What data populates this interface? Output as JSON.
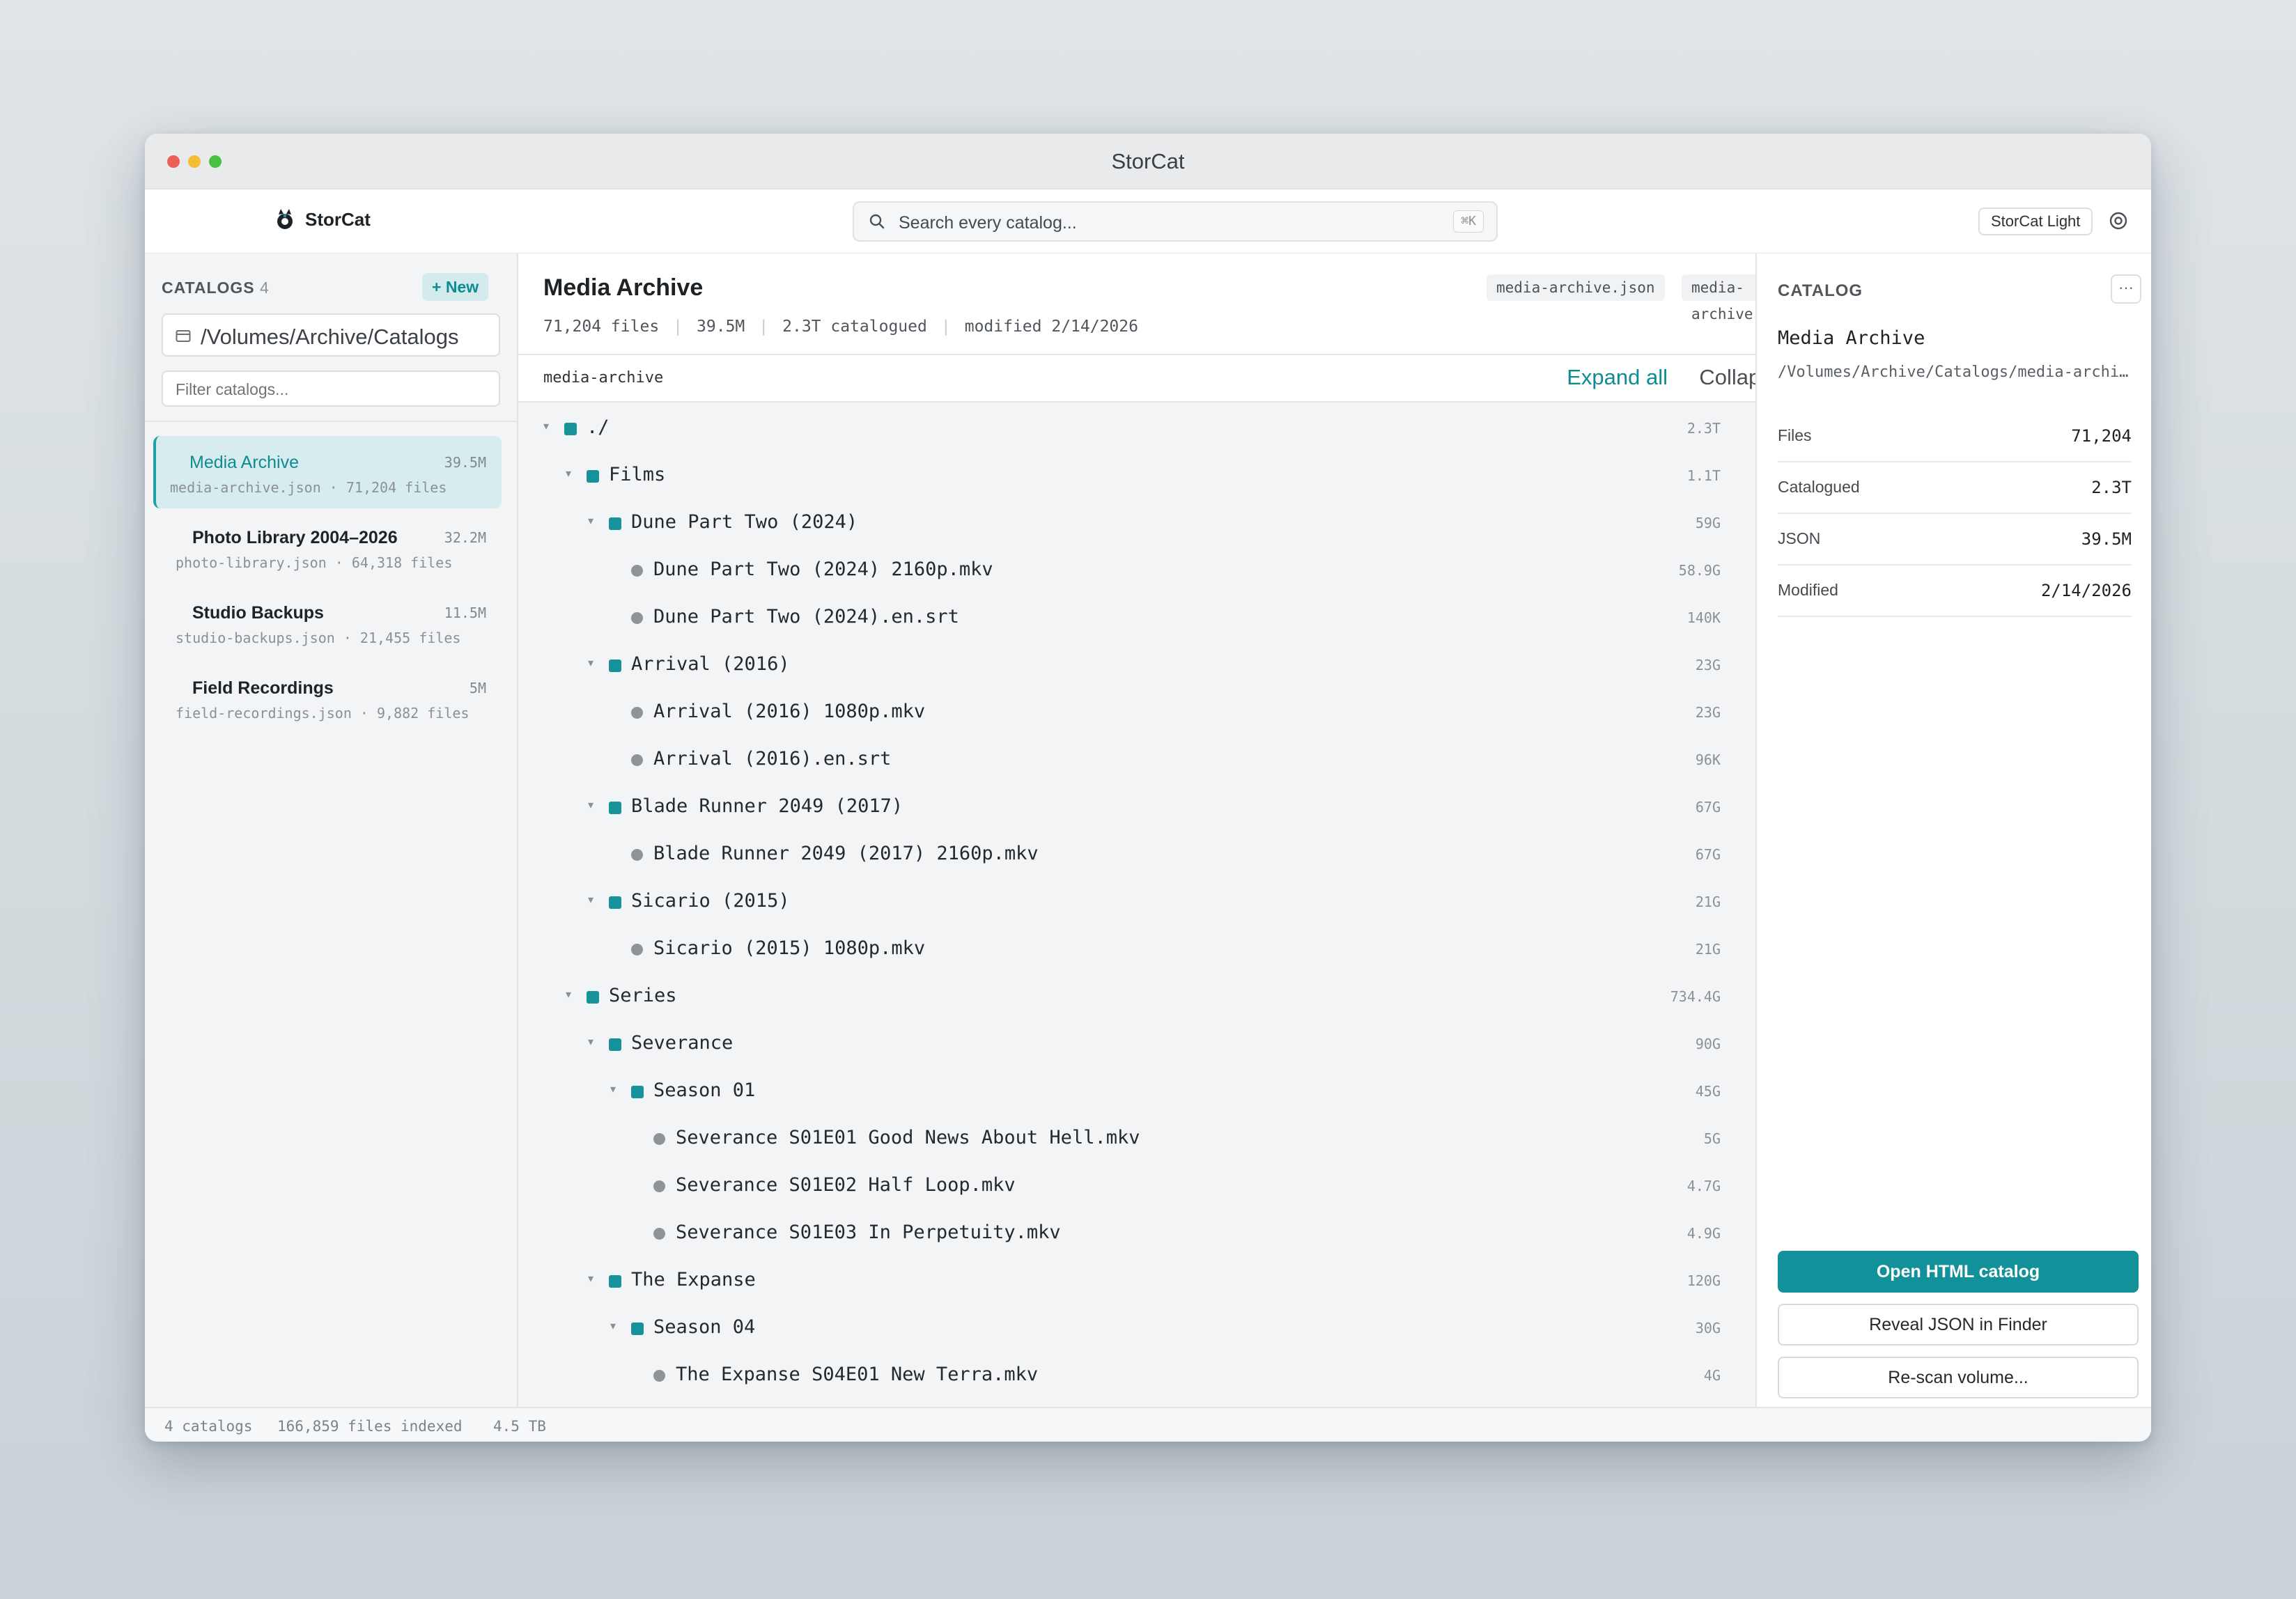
{
  "window": {
    "title": "StorCat"
  },
  "toolbar": {
    "brand": "StorCat",
    "search_placeholder": "Search every catalog...",
    "search_shortcut": "⌘K",
    "theme_label": "StorCat Light"
  },
  "sidebar": {
    "heading": "CATALOGS",
    "count": "4",
    "new_label": "+ New",
    "path": "/Volumes/Archive/Catalogs",
    "filter_placeholder": "Filter catalogs...",
    "items": [
      {
        "name": "Media Archive",
        "size": "39.5M",
        "meta": "media-archive.json · 71,204 files",
        "active": true
      },
      {
        "name": "Photo Library 2004–2026",
        "size": "32.2M",
        "meta": "photo-library.json · 64,318 files"
      },
      {
        "name": "Studio Backups",
        "size": "11.5M",
        "meta": "studio-backups.json · 21,455 files"
      },
      {
        "name": "Field Recordings",
        "size": "5M",
        "meta": "field-recordings.json · 9,882 files"
      }
    ]
  },
  "main": {
    "title": "Media Archive",
    "json_file": "media-archive.json",
    "html_file": "media-archive.html",
    "stats": [
      "71,204 files",
      "39.5M",
      "2.3T catalogued",
      "modified 2/14/2026"
    ],
    "tree_root_label": "media-archive",
    "expand_all": "Expand all",
    "collapse": "Collapse",
    "tree": [
      {
        "name": "./",
        "size": "2.3T",
        "depth": 0,
        "kind": "folder"
      },
      {
        "name": "Films",
        "size": "1.1T",
        "depth": 1,
        "kind": "folder"
      },
      {
        "name": "Dune Part Two (2024)",
        "size": "59G",
        "depth": 2,
        "kind": "folder"
      },
      {
        "name": "Dune Part Two (2024) 2160p.mkv",
        "size": "58.9G",
        "depth": 3,
        "kind": "file"
      },
      {
        "name": "Dune Part Two (2024).en.srt",
        "size": "140K",
        "depth": 3,
        "kind": "file"
      },
      {
        "name": "Arrival (2016)",
        "size": "23G",
        "depth": 2,
        "kind": "folder"
      },
      {
        "name": "Arrival (2016) 1080p.mkv",
        "size": "23G",
        "depth": 3,
        "kind": "file"
      },
      {
        "name": "Arrival (2016).en.srt",
        "size": "96K",
        "depth": 3,
        "kind": "file"
      },
      {
        "name": "Blade Runner 2049 (2017)",
        "size": "67G",
        "depth": 2,
        "kind": "folder"
      },
      {
        "name": "Blade Runner 2049 (2017) 2160p.mkv",
        "size": "67G",
        "depth": 3,
        "kind": "file"
      },
      {
        "name": "Sicario (2015)",
        "size": "21G",
        "depth": 2,
        "kind": "folder"
      },
      {
        "name": "Sicario (2015) 1080p.mkv",
        "size": "21G",
        "depth": 3,
        "kind": "file"
      },
      {
        "name": "Series",
        "size": "734.4G",
        "depth": 1,
        "kind": "folder"
      },
      {
        "name": "Severance",
        "size": "90G",
        "depth": 2,
        "kind": "folder"
      },
      {
        "name": "Season 01",
        "size": "45G",
        "depth": 3,
        "kind": "folder"
      },
      {
        "name": "Severance S01E01 Good News About Hell.mkv",
        "size": "5G",
        "depth": 4,
        "kind": "file"
      },
      {
        "name": "Severance S01E02 Half Loop.mkv",
        "size": "4.7G",
        "depth": 4,
        "kind": "file"
      },
      {
        "name": "Severance S01E03 In Perpetuity.mkv",
        "size": "4.9G",
        "depth": 4,
        "kind": "file"
      },
      {
        "name": "The Expanse",
        "size": "120G",
        "depth": 2,
        "kind": "folder"
      },
      {
        "name": "Season 04",
        "size": "30G",
        "depth": 3,
        "kind": "folder"
      },
      {
        "name": "The Expanse S04E01 New Terra.mkv",
        "size": "4G",
        "depth": 4,
        "kind": "file"
      }
    ]
  },
  "panel": {
    "heading": "CATALOG",
    "more_label": "···",
    "name": "Media Archive",
    "path": "/Volumes/Archive/Catalogs/media-archive.json",
    "props": [
      {
        "label": "Files",
        "value": "71,204"
      },
      {
        "label": "Catalogued",
        "value": "2.3T"
      },
      {
        "label": "JSON",
        "value": "39.5M"
      },
      {
        "label": "Modified",
        "value": "2/14/2026"
      }
    ],
    "open_html": "Open HTML catalog",
    "reveal_json": "Reveal JSON in Finder",
    "rescan": "Re-scan volume..."
  },
  "status": {
    "catalogs": "4 catalogs",
    "files": "166,859 files indexed",
    "size": "4.5 TB"
  },
  "colors": {
    "accent": "#12919a",
    "folder_marker": "#17929a",
    "file_marker": "#8f9499",
    "active_bg": "#d7ecee"
  }
}
